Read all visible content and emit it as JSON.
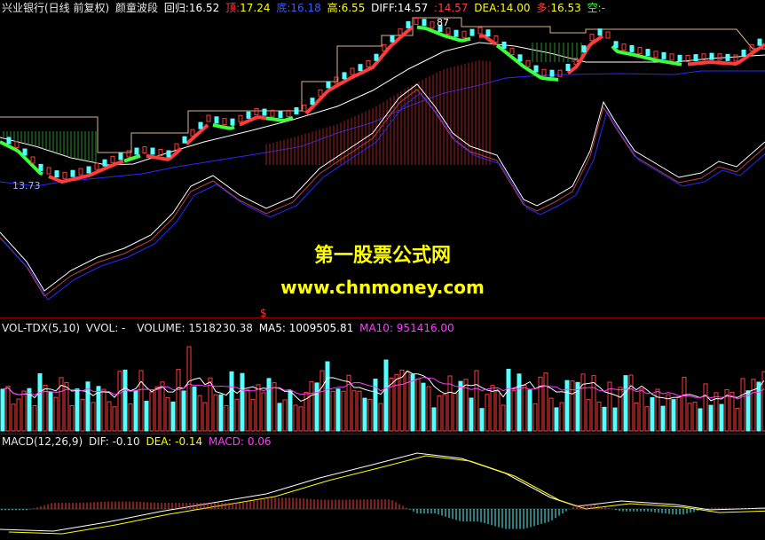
{
  "main_header": {
    "stock": "兴业银行(日线 前复权)",
    "indicator": "颜童波段",
    "huigui_label": "回归:",
    "huigui_value": "16.52",
    "ding_label": "顶:",
    "ding_value": "17.24",
    "di_label": "底:",
    "di_value": "16.18",
    "gao_label": "高:",
    "gao_value": "6.55",
    "diff_label": "DIFF:",
    "diff_value": "14.57",
    "diff2_value": ":14.57",
    "dea_label": "DEA:",
    "dea_value": "14.00",
    "duo_label": "多:",
    "duo_value": "16.53",
    "kong_label": "空:",
    "kong_value": "-"
  },
  "price_labels": {
    "low": "13.73",
    "high": "87"
  },
  "watermark": {
    "title": "第一股票公式网",
    "url": "www.chnmoney.com"
  },
  "marker": "$",
  "vol_header": {
    "name": "VOL-TDX(5,10)",
    "vvol": "VVOL: -",
    "volume": "VOLUME: 1518230.38",
    "ma5": "MA5: 1009505.81",
    "ma10": "MA10: 951416.00"
  },
  "macd_header": {
    "name": "MACD(12,26,9)",
    "dif": "DIF: -0.10",
    "dea": "DEA: -0.14",
    "macd": "MACD: 0.06"
  },
  "colors": {
    "up": "#ff3b3b",
    "down": "#54ffff",
    "green": "#3cff3c",
    "white": "#ffffff",
    "yellow": "#ffff00",
    "magenta": "#ff3cff",
    "blue": "#2a2aff",
    "tan": "#d9b48c"
  }
}
